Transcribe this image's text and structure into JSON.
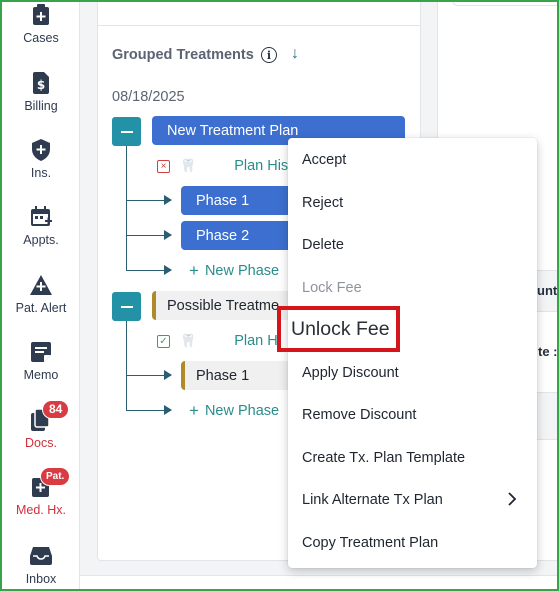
{
  "sidebar": {
    "items": [
      {
        "label": "Cases",
        "icon": "clipboard-plus-icon"
      },
      {
        "label": "Billing",
        "icon": "dollar-file-icon"
      },
      {
        "label": "Ins.",
        "icon": "shield-plus-icon"
      },
      {
        "label": "Appts.",
        "icon": "calendar-plus-icon"
      },
      {
        "label": "Pat. Alert",
        "icon": "warning-plus-icon"
      },
      {
        "label": "Memo",
        "icon": "memo-icon"
      },
      {
        "label": "Docs.",
        "icon": "documents-icon",
        "badge": "84"
      },
      {
        "label": "Med. Hx.",
        "icon": "medical-history-icon",
        "badge": "Pat."
      },
      {
        "label": "Inbox",
        "icon": "inbox-icon"
      }
    ]
  },
  "main": {
    "section_title": "Grouped Treatments",
    "date": "08/18/2025",
    "plans": [
      {
        "name": "New Treatment Plan",
        "history_label": "Plan His",
        "phases": [
          "Phase 1",
          "Phase 2"
        ],
        "new_phase_label": "New Phase"
      },
      {
        "name": "Possible Treatme",
        "history_label": "Plan H",
        "phases": [
          "Phase 1"
        ],
        "new_phase_label": "New Phase"
      }
    ]
  },
  "right": {
    "fragment1": "unts",
    "fragment2": "te :"
  },
  "context_menu": {
    "items": [
      {
        "label": "Accept",
        "enabled": true
      },
      {
        "label": "Reject",
        "enabled": true
      },
      {
        "label": "Delete",
        "enabled": true
      },
      {
        "label": "Lock Fee",
        "enabled": false
      },
      {
        "label": "Unlock Fee",
        "enabled": true,
        "highlighted": true
      },
      {
        "label": "Apply Discount",
        "enabled": true
      },
      {
        "label": "Remove Discount",
        "enabled": true
      },
      {
        "label": "Create Tx. Plan Template",
        "enabled": true
      },
      {
        "label": "Link Alternate Tx Plan",
        "enabled": true,
        "submenu": true
      },
      {
        "label": "Copy Treatment Plan",
        "enabled": true
      }
    ]
  },
  "colors": {
    "accent_blue": "#3c6fd0",
    "teal": "#2392a6",
    "highlight_red": "#d4151c",
    "badge_red": "#d93b43",
    "frame_green": "#37a34a"
  }
}
